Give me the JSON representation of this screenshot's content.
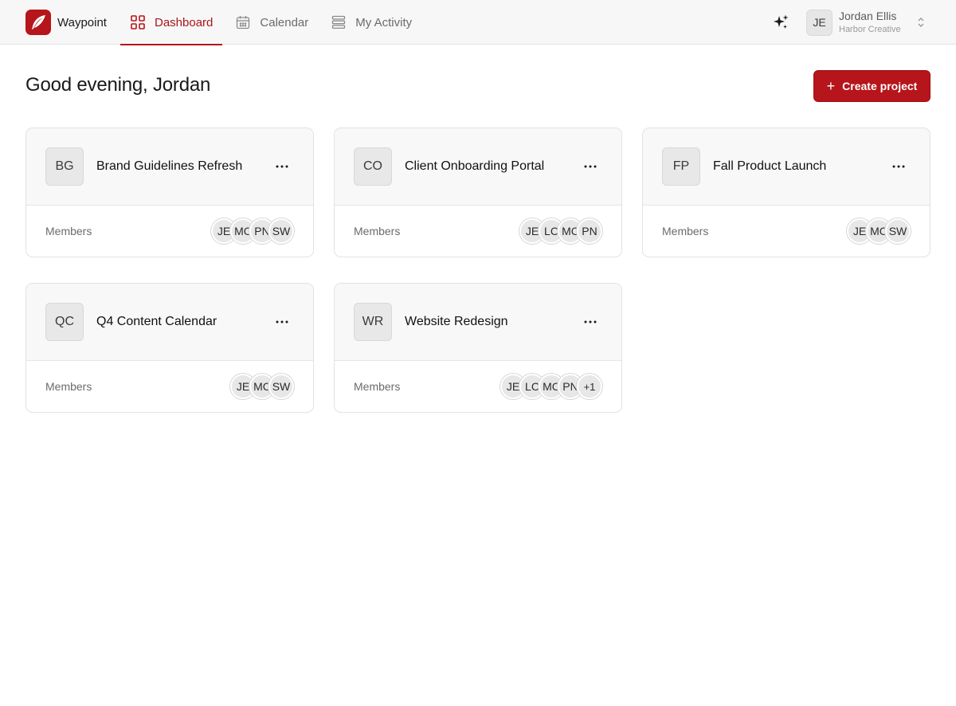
{
  "app": {
    "name": "Waypoint",
    "accent": "#b5151b"
  },
  "nav": {
    "tabs": [
      {
        "label": "Dashboard",
        "icon": "grid-icon",
        "active": true
      },
      {
        "label": "Calendar",
        "icon": "calendar-icon",
        "active": false
      },
      {
        "label": "My Activity",
        "icon": "list-icon",
        "active": false
      }
    ]
  },
  "user": {
    "initials": "JE",
    "name": "Jordan Ellis",
    "org": "Harbor Creative"
  },
  "main": {
    "greeting": "Good evening, Jordan",
    "create_label": "Create project",
    "members_label": "Members",
    "projects": [
      {
        "initials": "BG",
        "name": "Brand Guidelines Refresh",
        "members": [
          "JE",
          "MC",
          "PN",
          "SW"
        ]
      },
      {
        "initials": "CO",
        "name": "Client Onboarding Portal",
        "members": [
          "JE",
          "LC",
          "MC",
          "PN"
        ]
      },
      {
        "initials": "FP",
        "name": "Fall Product Launch",
        "members": [
          "JE",
          "MC",
          "SW"
        ]
      },
      {
        "initials": "QC",
        "name": "Q4 Content Calendar",
        "members": [
          "JE",
          "MC",
          "SW"
        ]
      },
      {
        "initials": "WR",
        "name": "Website Redesign",
        "members": [
          "JE",
          "LC",
          "MC",
          "PN",
          "+1"
        ]
      }
    ]
  }
}
